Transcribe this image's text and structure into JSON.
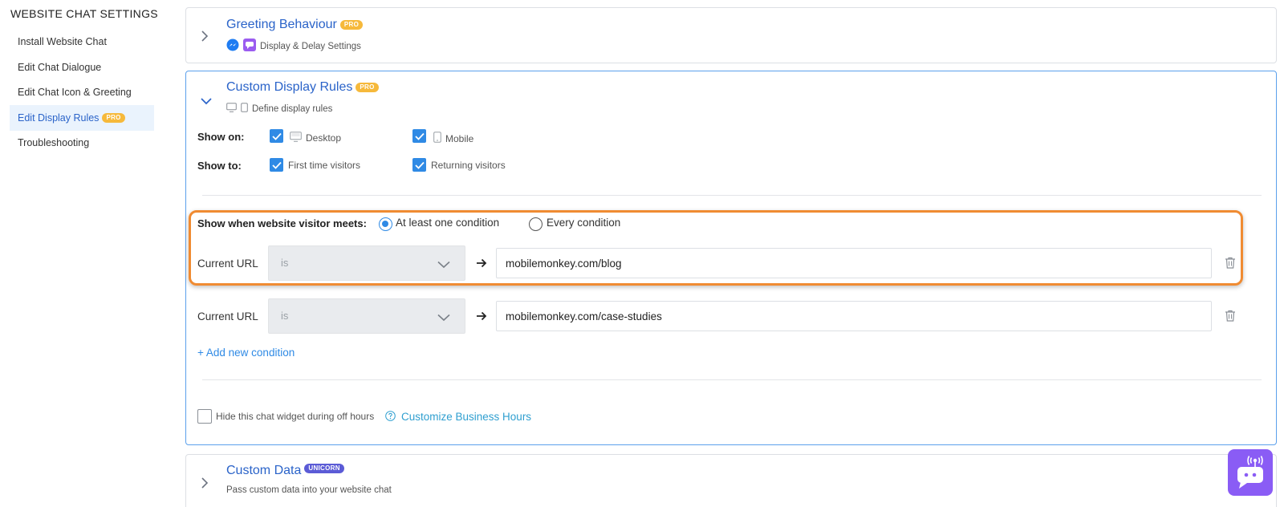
{
  "sidebar": {
    "title": "WEBSITE CHAT SETTINGS",
    "items": [
      {
        "label": "Install Website Chat"
      },
      {
        "label": "Edit Chat Dialogue"
      },
      {
        "label": "Edit Chat Icon & Greeting"
      },
      {
        "label": "Edit Display Rules",
        "badge": "PRO",
        "active": true
      },
      {
        "label": "Troubleshooting"
      }
    ]
  },
  "greeting": {
    "title": "Greeting Behaviour",
    "badge": "PRO",
    "subtitle": "Display & Delay Settings"
  },
  "display_rules": {
    "title": "Custom Display Rules",
    "badge": "PRO",
    "subtitle": "Define display rules",
    "show_on": {
      "label": "Show on:",
      "desktop": "Desktop",
      "mobile": "Mobile"
    },
    "show_to": {
      "label": "Show to:",
      "first_time": "First time visitors",
      "returning": "Returning visitors"
    },
    "meets": {
      "label": "Show when website visitor meets:",
      "option_one": "At least one condition",
      "option_every": "Every condition"
    },
    "conditions": [
      {
        "label": "Current URL",
        "operator": "is",
        "value": "mobilemonkey.com/blog"
      },
      {
        "label": "Current URL",
        "operator": "is",
        "value": "mobilemonkey.com/case-studies"
      }
    ],
    "add_condition": "+ Add new condition",
    "hide_off_hours": "Hide this chat widget during off hours",
    "customize_hours": "Customize Business Hours"
  },
  "custom_data": {
    "title": "Custom Data",
    "badge": "UNICORN",
    "subtitle": "Pass custom data into your website chat"
  },
  "colors": {
    "accent": "#2a63c9",
    "checkbox": "#2f8ae5",
    "highlight": "#f08b32",
    "bot": "#8a5cf5"
  }
}
